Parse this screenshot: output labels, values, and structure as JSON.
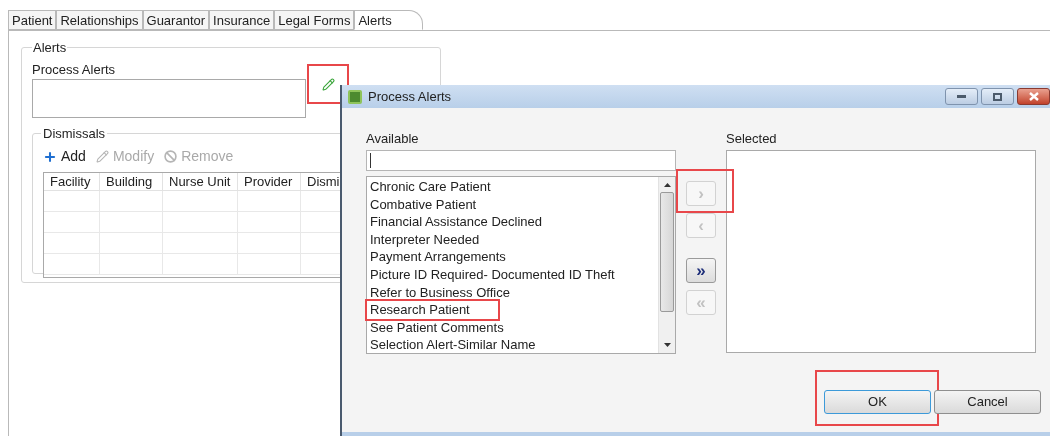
{
  "tabs": [
    {
      "label": "Patient",
      "selected": false
    },
    {
      "label": "Relationships",
      "selected": false
    },
    {
      "label": "Guarantor",
      "selected": false
    },
    {
      "label": "Insurance",
      "selected": false
    },
    {
      "label": "Legal Forms",
      "selected": false
    },
    {
      "label": "Alerts",
      "selected": true
    }
  ],
  "alerts_group": {
    "title": "Alerts",
    "process_alerts": {
      "label": "Process Alerts",
      "edit_highlighted": true
    },
    "dismissals": {
      "title": "Dismissals",
      "toolbar": [
        {
          "kind": "add",
          "label": "Add",
          "disabled": false
        },
        {
          "kind": "modify",
          "label": "Modify",
          "disabled": true
        },
        {
          "kind": "remove",
          "label": "Remove",
          "disabled": true
        }
      ],
      "columns": [
        "Facility",
        "Building",
        "Nurse Unit",
        "Provider",
        "Dismi"
      ]
    }
  },
  "dialog": {
    "title": "Process Alerts",
    "available": {
      "label": "Available",
      "items": [
        {
          "label": "Chronic Care Patient",
          "highlighted": false
        },
        {
          "label": "Combative Patient",
          "highlighted": false
        },
        {
          "label": "Financial Assistance Declined",
          "highlighted": false
        },
        {
          "label": "Interpreter Needed",
          "highlighted": false
        },
        {
          "label": "Payment Arrangements",
          "highlighted": false
        },
        {
          "label": "Picture ID Required- Documented ID Theft",
          "highlighted": false
        },
        {
          "label": "Refer to Business Office",
          "highlighted": false
        },
        {
          "label": "Research Patient",
          "highlighted": true
        },
        {
          "label": "See Patient Comments",
          "highlighted": false
        },
        {
          "label": "Selection Alert-Similar Name",
          "highlighted": false
        }
      ]
    },
    "transfer_buttons": [
      {
        "label": "›",
        "disabled": true,
        "highlighted": true
      },
      {
        "label": "‹",
        "disabled": true,
        "highlighted": false
      },
      {
        "label": "»",
        "disabled": false,
        "highlighted": false
      },
      {
        "label": "«",
        "disabled": true,
        "highlighted": false
      }
    ],
    "selected": {
      "label": "Selected"
    },
    "buttons": [
      {
        "label": "OK",
        "default": true,
        "highlighted": true
      },
      {
        "label": "Cancel",
        "default": false,
        "highlighted": false
      }
    ]
  }
}
